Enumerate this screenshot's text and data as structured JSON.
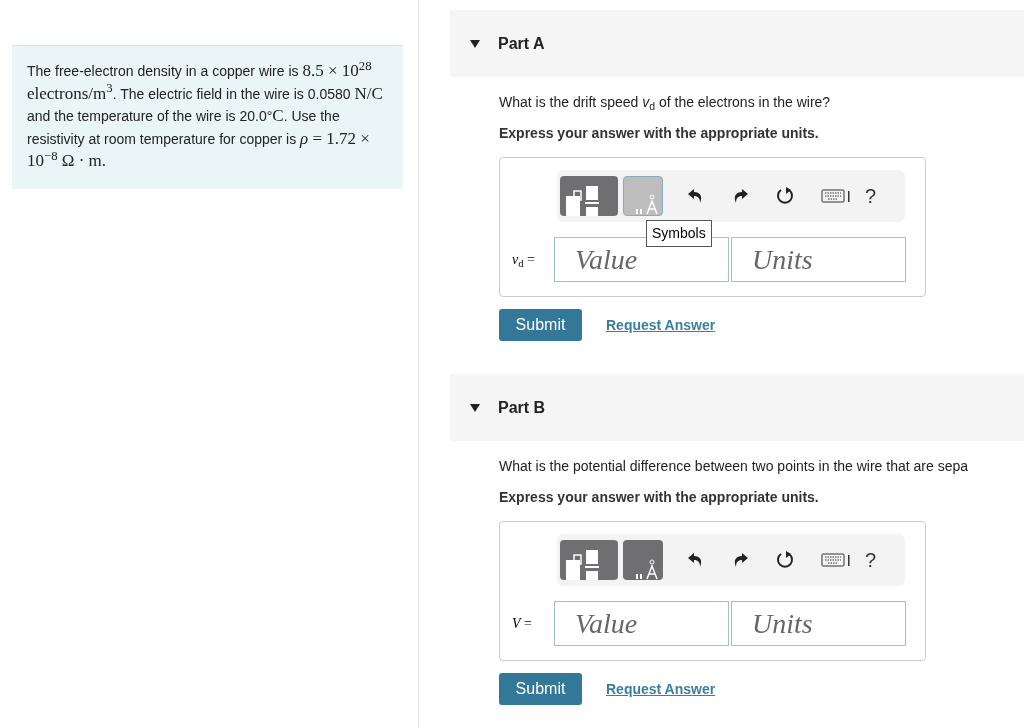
{
  "problem": [
    {
      "kind": "text",
      "text": "The free-electron density in a copper wire is "
    },
    {
      "kind": "math",
      "text": "8.5 × 10$^{28}$ electrons/m$^{3}$"
    },
    {
      "kind": "text",
      "text": ". The electric field in the wire is 0.0580 "
    },
    {
      "kind": "math",
      "text": "N/C"
    },
    {
      "kind": "text",
      "text": " and the temperature of the wire is 20.0°"
    },
    {
      "kind": "math",
      "text": "C"
    },
    {
      "kind": "text",
      "text": ". Use the resistivity at room temperature for copper is "
    },
    {
      "kind": "math",
      "text": "*ρ* = 1.72 × 10$^{−8}$ Ω · m."
    }
  ],
  "parts": [
    {
      "title": "Part A",
      "expanded": true,
      "question": "What is the drift speed *v*$_{d}$ of the electrons in the wire?",
      "instruction": "Express your answer with the appropriate units.",
      "symbols_hovered": true,
      "tooltip": "Symbols",
      "help": "?",
      "label": "*v*$_{d}$ =",
      "value_placeholder": "Value",
      "units_placeholder": "Units",
      "submit": "Submit",
      "request": "Request Answer"
    },
    {
      "title": "Part B",
      "expanded": true,
      "question": "What is the potential difference between two points in the wire that are sepa",
      "instruction": "Express your answer with the appropriate units.",
      "symbols_hovered": false,
      "help": "?",
      "label": "*V* =",
      "value_placeholder": "Value",
      "units_placeholder": "Units",
      "submit": "Submit",
      "request": "Request Answer"
    }
  ]
}
